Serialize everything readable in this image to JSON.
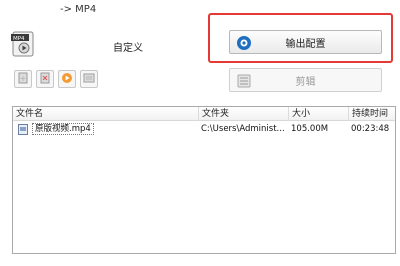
{
  "window": {
    "title": "-> MP4"
  },
  "format": {
    "caption": "自定义",
    "icon": "mp4-file-icon"
  },
  "buttons": {
    "output_config": "输出配置",
    "cut": "剪辑"
  },
  "toolbar": {
    "items": [
      "add-file-icon",
      "remove-file-icon",
      "play-icon",
      "media-info-icon"
    ]
  },
  "file_list": {
    "columns": [
      "文件名",
      "文件夹",
      "大小",
      "持续时间"
    ],
    "rows": [
      {
        "name": "原版视频.mp4",
        "folder": "C:\\Users\\Administ...",
        "size": "105.00M",
        "duration": "00:23:48"
      }
    ]
  },
  "colors": {
    "highlight": "#e53935",
    "accent": "#1e6fc0"
  }
}
